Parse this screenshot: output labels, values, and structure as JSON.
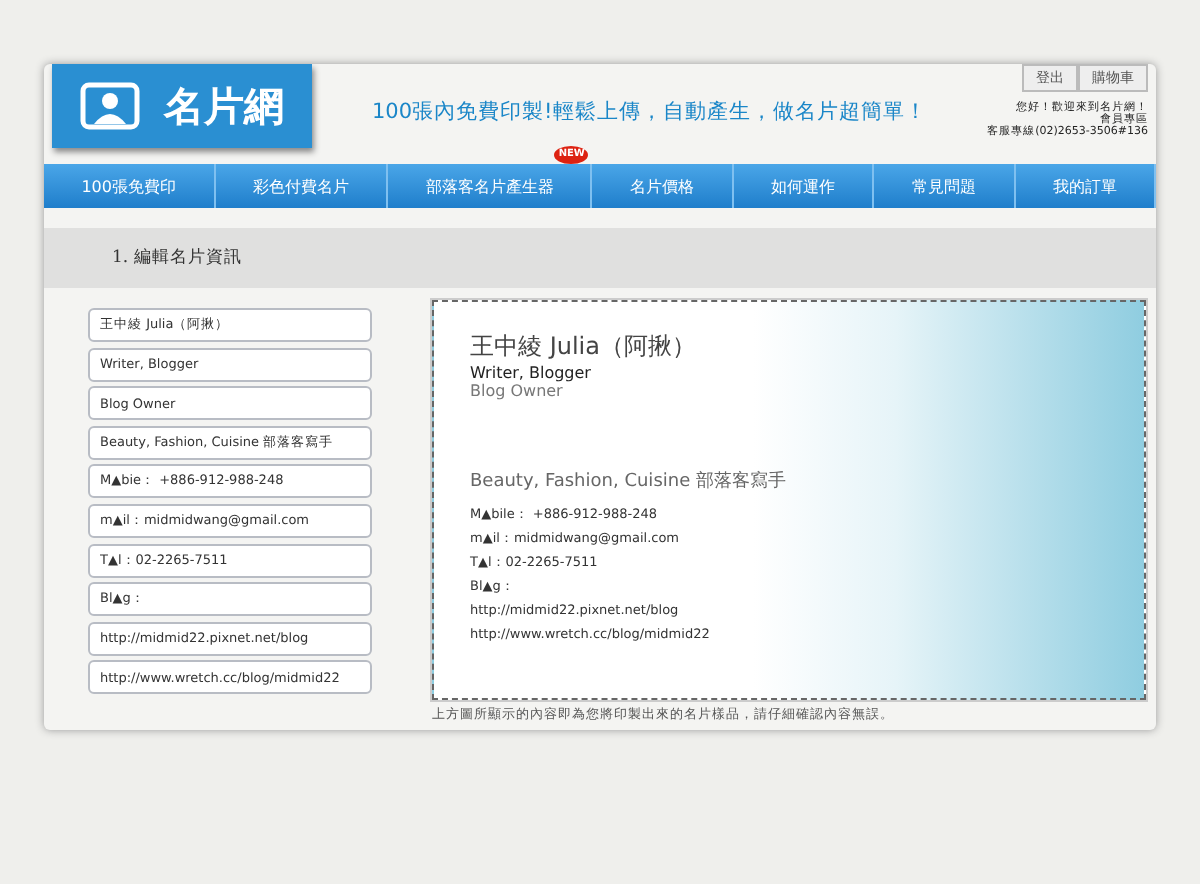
{
  "header": {
    "logo_text": "名片網",
    "slogan": "100張內免費印製!輕鬆上傳，自動產生，做名片超簡單！",
    "top_buttons": [
      "登出",
      "購物車"
    ],
    "member_info": [
      "您好！歡迎來到名片網！",
      "會員專區",
      "客服專線(02)2653-3506#136"
    ]
  },
  "nav": [
    {
      "label": "100張免費印"
    },
    {
      "label": "彩色付費名片"
    },
    {
      "label": "部落客名片產生器",
      "badge": "NEW"
    },
    {
      "label": "名片價格"
    },
    {
      "label": "如何運作"
    },
    {
      "label": "常見問題"
    },
    {
      "label": "我的訂單"
    }
  ],
  "section_title": "1. 編輯名片資訊",
  "fields": [
    "王中綾 Julia（阿揪）",
    "Writer, Blogger",
    "Blog Owner",
    "Beauty, Fashion, Cuisine 部落客寫手",
    "M▲bie： +886-912-988-248",
    "m▲il：midmidwang@gmail.com",
    "T▲l：02-2265-7511",
    "Bl▲g：",
    "http://midmid22.pixnet.net/blog",
    "http://www.wretch.cc/blog/midmid22"
  ],
  "card_lines": [
    {
      "kind": "name",
      "text": "王中綾 Julia（阿揪）"
    },
    {
      "kind": "title",
      "text": "Writer, Blogger"
    },
    {
      "kind": "subtitle",
      "text": "Blog Owner"
    },
    {
      "kind": "tagline",
      "text": "Beauty, Fashion, Cuisine 部落客寫手"
    },
    {
      "kind": "detail",
      "text": "M▲bile： +886-912-988-248"
    },
    {
      "kind": "detail",
      "text": "m▲il：midmidwang@gmail.com"
    },
    {
      "kind": "detail",
      "text": "T▲l：02-2265-7511"
    },
    {
      "kind": "detail",
      "text": "Bl▲g："
    },
    {
      "kind": "detail",
      "text": "http://midmid22.pixnet.net/blog"
    },
    {
      "kind": "detail",
      "text": "http://www.wretch.cc/blog/midmid22"
    }
  ],
  "caption": "上方圖所顯示的內容即為您將印製出來的名片樣品，請仔細確認內容無誤。"
}
